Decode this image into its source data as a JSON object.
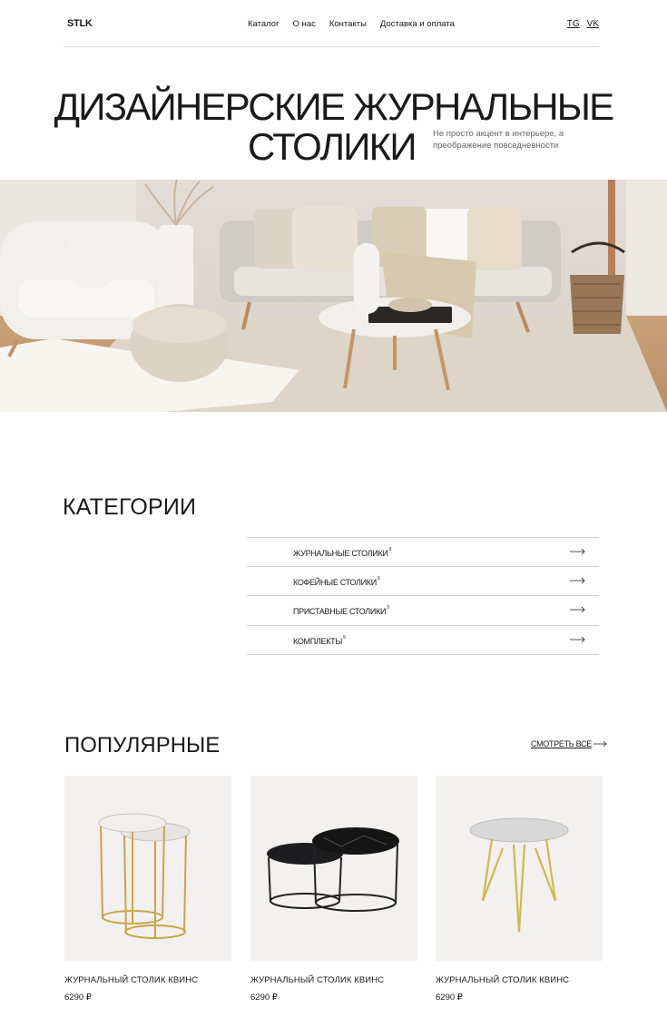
{
  "header": {
    "logo": "STLK",
    "nav": [
      "Каталог",
      "О нас",
      "Контакты",
      "Доставка и оплата"
    ],
    "social": [
      "TG",
      "VK"
    ]
  },
  "hero": {
    "title_line1": "ДИЗАЙНЕРСКИЕ ЖУРНАЛЬНЫЕ",
    "title_line2": "СТОЛИКИ",
    "subtitle": "Не просто акцент в интерьере, а преображение повседневности"
  },
  "categories": {
    "title": "КАТЕГОРИИ",
    "items": [
      {
        "label": "ЖУРНАЛЬНЫЕ СТОЛИКИ",
        "count": "9"
      },
      {
        "label": "КОФЕЙНЫЕ СТОЛИКИ",
        "count": "9"
      },
      {
        "label": "ПРИСТАВНЫЕ СТОЛИКИ",
        "count": "9"
      },
      {
        "label": "КОМПЛЕКТЫ",
        "count": "9"
      }
    ]
  },
  "popular": {
    "title": "ПОПУЛЯРНЫЕ",
    "see_all": "СМОТРЕТЬ ВСЕ",
    "products": [
      {
        "name": "ЖУРНАЛЬНЫЙ СТОЛИК КВИНС",
        "price": "6290 ₽"
      },
      {
        "name": "ЖУРНАЛЬНЫЙ СТОЛИК КВИНС",
        "price": "6290 ₽"
      },
      {
        "name": "ЖУРНАЛЬНЫЙ СТОЛИК КВИНС",
        "price": "6290 ₽"
      }
    ]
  },
  "icons": {
    "arrow": "arrow-right-icon"
  }
}
